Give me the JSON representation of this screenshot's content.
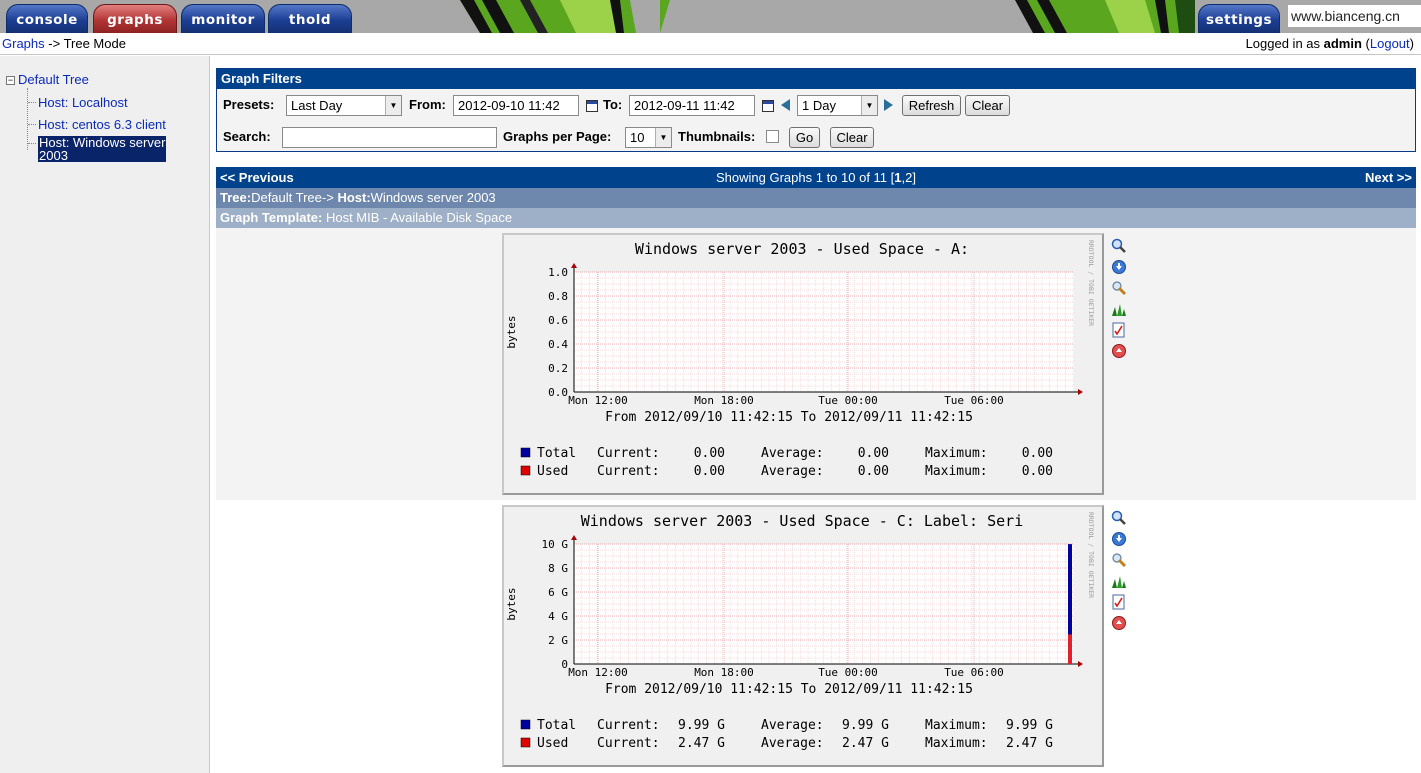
{
  "tabs": [
    {
      "label": "console",
      "active": false
    },
    {
      "label": "graphs",
      "active": true
    },
    {
      "label": "monitor",
      "active": false
    },
    {
      "label": "thold",
      "active": false
    }
  ],
  "settings_tab": "settings",
  "watermark": "www.bianceng.cn",
  "breadcrumb": {
    "link": "Graphs",
    "sep": " -> ",
    "current": "Tree Mode"
  },
  "login": {
    "prefix": "Logged in as ",
    "user": "admin",
    "logout_open": " (",
    "logout": "Logout",
    "logout_close": ")"
  },
  "tree": {
    "root": "Default Tree",
    "items": [
      {
        "label": "Host: Localhost",
        "selected": false
      },
      {
        "label": "Host: centos 6.3 client",
        "selected": false
      },
      {
        "label_line1": "Host: Windows server",
        "label_line2": "2003",
        "selected": true
      }
    ]
  },
  "filters": {
    "title": "Graph Filters",
    "presets_label": "Presets:",
    "presets_value": "Last Day",
    "from_label": "From:",
    "from_value": "2012-09-10 11:42",
    "to_label": "To:",
    "to_value": "2012-09-11 11:42",
    "span_value": "1 Day",
    "refresh": "Refresh",
    "clear": "Clear",
    "search_label": "Search:",
    "search_value": "",
    "gpp_label": "Graphs per Page:",
    "gpp_value": "10",
    "thumbs_label": "Thumbnails:",
    "thumbs_checked": false,
    "go": "Go",
    "clear2": "Clear"
  },
  "paging": {
    "prev": "<< Previous",
    "showing": "Showing Graphs 1 to 10 of 11 [",
    "page1": "1",
    "comma": ",",
    "page2": "2",
    "close": "]",
    "next": "Next >>"
  },
  "tree_header": {
    "tree_label": "Tree:",
    "tree_value": "Default Tree-> ",
    "host_label": "Host:",
    "host_value": "Windows server 2003"
  },
  "template_header": {
    "label": "Graph Template:",
    "value": " Host MIB - Available Disk Space"
  },
  "graphs": [
    {
      "title": "Windows server 2003 - Used Space - A:",
      "ylabel": "bytes",
      "yticks": [
        "1.0",
        "0.8",
        "0.6",
        "0.4",
        "0.2",
        "0.0"
      ],
      "xticks": [
        "Mon 12:00",
        "Mon 18:00",
        "Tue 00:00",
        "Tue 06:00"
      ],
      "from_to": "From 2012/09/10 11:42:15 To 2012/09/11 11:42:15",
      "watermark": "RRDTOOL / TOBI OETIKER",
      "legend": [
        {
          "name": "Total",
          "color": "#0000a0",
          "current": "0.00",
          "average": "0.00",
          "maximum": "0.00"
        },
        {
          "name": "Used",
          "color": "#e00000",
          "current": "0.00",
          "average": "0.00",
          "maximum": "0.00"
        }
      ],
      "labels": {
        "current": "Current:",
        "average": "Average:",
        "maximum": "Maximum:"
      }
    },
    {
      "title": "Windows server 2003 - Used Space - C: Label:  Seri",
      "ylabel": "bytes",
      "yticks": [
        "10 G",
        "8 G",
        "6 G",
        "4 G",
        "2 G",
        "0"
      ],
      "xticks": [
        "Mon 12:00",
        "Mon 18:00",
        "Tue 00:00",
        "Tue 06:00"
      ],
      "from_to": "From 2012/09/10 11:42:15 To 2012/09/11 11:42:15",
      "watermark": "RRDTOOL / TOBI OETIKER",
      "total_value_g": 9.99,
      "used_value_g": 2.47,
      "legend": [
        {
          "name": "Total",
          "color": "#0000a0",
          "current": "9.99 G",
          "average": "9.99 G",
          "maximum": "9.99 G"
        },
        {
          "name": "Used",
          "color": "#e00000",
          "current": "2.47 G",
          "average": "2.47 G",
          "maximum": "2.47 G"
        }
      ],
      "labels": {
        "current": "Current:",
        "average": "Average:",
        "maximum": "Maximum:"
      }
    }
  ],
  "action_icons": [
    "zoom-icon",
    "export-icon",
    "properties-icon",
    "graph-list-icon",
    "realtime-icon",
    "back-to-top-icon"
  ]
}
